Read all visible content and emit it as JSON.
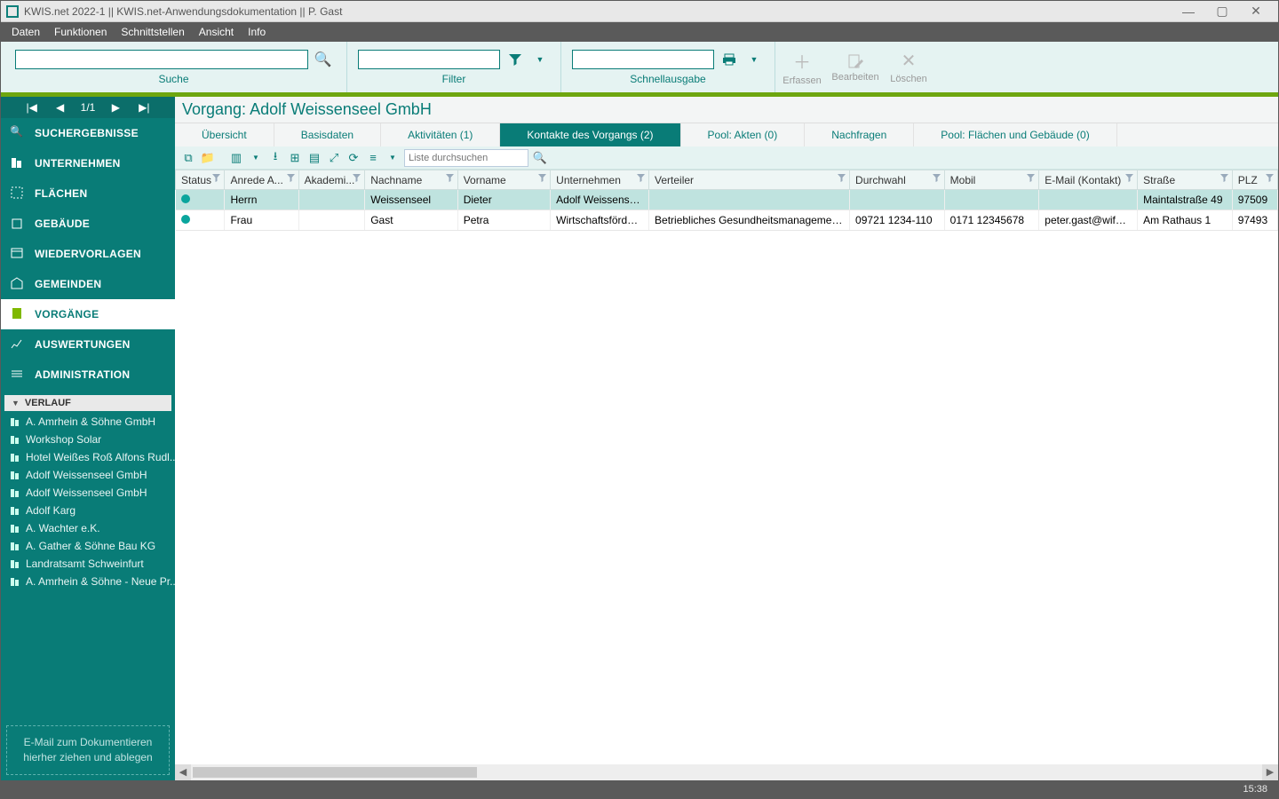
{
  "window": {
    "title": "KWIS.net 2022-1 || KWIS.net-Anwendungsdokumentation || P. Gast"
  },
  "menubar": [
    "Daten",
    "Funktionen",
    "Schnittstellen",
    "Ansicht",
    "Info"
  ],
  "toolbar": {
    "search_label": "Suche",
    "filter_label": "Filter",
    "quick_label": "Schnellausgabe",
    "erfassen": "Erfassen",
    "bearbeiten": "Bearbeiten",
    "loeschen": "Löschen"
  },
  "nav": {
    "pager": "1/1"
  },
  "sidebar": {
    "items": [
      {
        "label": "SUCHERGEBNISSE"
      },
      {
        "label": "UNTERNEHMEN"
      },
      {
        "label": "FLÄCHEN"
      },
      {
        "label": "GEBÄUDE"
      },
      {
        "label": "WIEDERVORLAGEN"
      },
      {
        "label": "GEMEINDEN"
      },
      {
        "label": "VORGÄNGE"
      },
      {
        "label": "AUSWERTUNGEN"
      },
      {
        "label": "ADMINISTRATION"
      }
    ],
    "verlauf_header": "VERLAUF",
    "history": [
      "A. Amrhein & Söhne GmbH",
      "Workshop Solar",
      "Hotel Weißes Roß Alfons Rudl...",
      "Adolf Weissenseel GmbH",
      "Adolf Weissenseel GmbH",
      "Adolf Karg",
      "A. Wachter e.K.",
      "A. Gather & Söhne Bau KG",
      "Landratsamt Schweinfurt",
      "A. Amrhein & Söhne - Neue Pr..."
    ],
    "dropzone_l1": "E-Mail  zum Dokumentieren",
    "dropzone_l2": "hierher ziehen und ablegen"
  },
  "main": {
    "title": "Vorgang: Adolf Weissenseel GmbH",
    "tabs": [
      {
        "label": "Übersicht"
      },
      {
        "label": "Basisdaten"
      },
      {
        "label": "Aktivitäten (1)"
      },
      {
        "label": "Kontakte des Vorgangs (2)"
      },
      {
        "label": "Pool: Akten (0)"
      },
      {
        "label": "Nachfragen"
      },
      {
        "label": "Pool: Flächen und Gebäude (0)"
      }
    ],
    "grid_search_placeholder": "Liste durchsuchen",
    "columns": [
      "Status",
      "Anrede A...",
      "Akademi...",
      "Nachname",
      "Vorname",
      "Unternehmen",
      "Verteiler",
      "Durchwahl",
      "Mobil",
      "E-Mail (Kontakt)",
      "Straße",
      "PLZ"
    ],
    "rows": [
      {
        "status": "●",
        "anrede": "Herrn",
        "akad": "",
        "nachname": "Weissenseel",
        "vorname": "Dieter",
        "unternehmen": "Adolf Weissense...",
        "verteiler": "",
        "durchwahl": "",
        "mobil": "",
        "email": "",
        "strasse": "Maintalstraße 49",
        "plz": "97509"
      },
      {
        "status": "●",
        "anrede": "Frau",
        "akad": "",
        "nachname": "Gast",
        "vorname": "Petra",
        "unternehmen": "Wirtschaftsförder...",
        "verteiler": "Betriebliches Gesundheitsmanagement fü...",
        "durchwahl": "09721 1234-110",
        "mobil": "0171 12345678",
        "email": "peter.gast@wifoe.b...",
        "strasse": "Am Rathaus 1",
        "plz": "97493"
      }
    ]
  },
  "status": {
    "time": "15:38"
  }
}
